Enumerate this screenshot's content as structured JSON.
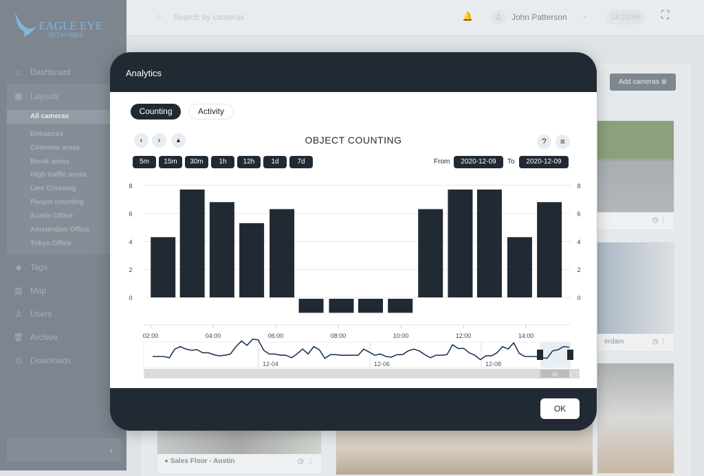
{
  "brand": {
    "line1": "EAGLE EYE",
    "line2": "NETWORKS"
  },
  "header": {
    "search_placeholder": "Search by cameras",
    "user": "John Patterson",
    "clock": "18:22:49"
  },
  "sidebar": {
    "items": [
      {
        "label": "Dashboard",
        "icon": "home-icon"
      },
      {
        "label": "Layouts",
        "icon": "layouts-icon"
      },
      {
        "label": "Tags",
        "icon": "tag-icon"
      },
      {
        "label": "Map",
        "icon": "map-icon"
      },
      {
        "label": "Users",
        "icon": "user-icon"
      },
      {
        "label": "Archive",
        "icon": "trash-icon"
      },
      {
        "label": "Downloads",
        "icon": "download-icon"
      }
    ],
    "layouts": [
      "All cameras",
      "Entrances",
      "Common areas",
      "Break areas",
      "High traffic areas",
      "Line Crossing",
      "People counting",
      "Austin Office",
      "Amsterdam Office",
      "Tokyo Office"
    ]
  },
  "main": {
    "add_cameras": "Add cameras",
    "tiles": [
      {
        "name": ""
      },
      {
        "name": "erdam"
      },
      {
        "name": "Sales Floor - Austin"
      }
    ]
  },
  "modal": {
    "title": "Analytics",
    "tabs": [
      "Counting",
      "Activity"
    ],
    "chart_title": "OBJECT COUNTING",
    "ranges": [
      "5m",
      "15m",
      "30m",
      "1h",
      "12h",
      "1d",
      "7d"
    ],
    "from_label": "From",
    "from": "2020-12-09",
    "to_label": "To",
    "to": "2020-12-09",
    "ok": "OK"
  },
  "colors": {
    "dark": "#212a33",
    "accent": "#4aa3df"
  },
  "chart_data": {
    "type": "bar",
    "title": "OBJECT COUNTING",
    "ylim": [
      -1.5,
      8
    ],
    "yticks": [
      0,
      2,
      4,
      6,
      8
    ],
    "xlim": [
      "02:00",
      "15:30"
    ],
    "xticks": [
      "02:00",
      "04:00",
      "06:00",
      "08:00",
      "10:00",
      "12:00",
      "14:00"
    ],
    "grid": true,
    "x": [
      "02:24",
      "03:20",
      "04:17",
      "05:14",
      "06:12",
      "07:08",
      "08:06",
      "09:02",
      "09:59",
      "10:57",
      "11:54",
      "12:50",
      "13:48",
      "14:45"
    ],
    "values": [
      4.3,
      7.7,
      6.8,
      5.3,
      6.3,
      -1,
      -1,
      -1,
      -1,
      6.3,
      7.7,
      7.7,
      4.3,
      6.8
    ],
    "navigator": {
      "labels": [
        "12-04",
        "12-06",
        "12-08"
      ],
      "values": [
        2,
        2,
        2,
        1.8,
        3.2,
        3.6,
        3.2,
        3,
        3.1,
        2.6,
        2.6,
        2.3,
        2.1,
        2.2,
        2.4,
        3.6,
        4.5,
        3.8,
        4.8,
        4.7,
        3,
        2.4,
        2.4,
        2.2,
        2.2,
        1.8,
        2.4,
        3.2,
        2.4,
        3.6,
        3.1,
        1.7,
        2.3,
        2.3,
        2.2,
        2.2,
        2.2,
        2.2,
        3.2,
        2.7,
        2.2,
        2.4,
        2,
        1.9,
        2.3,
        2.3,
        2.9,
        3.2,
        2.9,
        2.3,
        1.8,
        2.2,
        2.2,
        2.3,
        3.9,
        3.3,
        3.3,
        2.6,
        2.2,
        1.5,
        2.1,
        2.1,
        2.6,
        3.6,
        3.2,
        4.2,
        2.5,
        2,
        2,
        2,
        1.8,
        1.7,
        2.9,
        3.1,
        3.6,
        3.5
      ]
    }
  }
}
